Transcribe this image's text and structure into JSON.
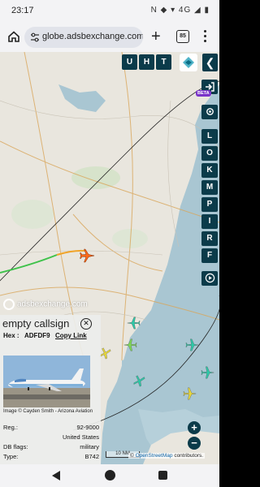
{
  "status_bar": {
    "time": "23:17",
    "icons": "N ◆ ▾ 4G ◢ ▮"
  },
  "browser": {
    "url": "globe.adsbexchange.com/?",
    "tab_count": "85"
  },
  "toolbar": {
    "u_label": "U",
    "h_label": "H",
    "t_label": "T",
    "collapse_label": "❮"
  },
  "sidebar": {
    "beta_label": "BETA",
    "buttons": [
      "L",
      "O",
      "K",
      "M",
      "P",
      "I",
      "R",
      "F"
    ]
  },
  "watermark": "adsbexchange.com",
  "aircraft_panel": {
    "callsign": "empty callsign",
    "hex_label": "Hex :",
    "hex_value": "ADFDF9",
    "copy_link": "Copy Link",
    "photo_credit": "Image © Cayden Smith - Arizona Aviation",
    "rows": [
      {
        "key": "Reg.:",
        "value": "92-9000"
      },
      {
        "key": "",
        "value": "United States"
      },
      {
        "key": "DB flags:",
        "value": "military"
      },
      {
        "key": "Type:",
        "value": "B742"
      }
    ]
  },
  "map_controls": {
    "zoom_in": "+",
    "zoom_out": "−",
    "scale": "10 NM",
    "attribution_prefix": "©",
    "attribution_link": "OpenStreetMap",
    "attribution_suffix": "contributors."
  },
  "colors": {
    "panel_dark": "#0b3b4a",
    "beta": "#7a34c9",
    "sea": "#a9c6d2",
    "land": "#e9e6de",
    "selected_plane": "#ff6a1a",
    "plane_green": "#7ed957",
    "plane_cyan": "#2cc9a8",
    "plane_yellow": "#e8d83a"
  }
}
